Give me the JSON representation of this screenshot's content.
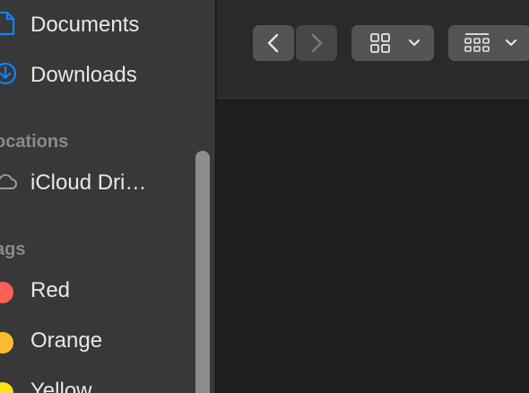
{
  "sidebar": {
    "favorites": [
      {
        "label": "Documents",
        "icon": "document-icon"
      },
      {
        "label": "Downloads",
        "icon": "download-icon"
      }
    ],
    "locations_header": "ocations",
    "locations": [
      {
        "label": "iCloud Dri…",
        "icon": "cloud-icon"
      }
    ],
    "tags_header": "ags",
    "tags": [
      {
        "label": "Red",
        "color": "#fe5f57"
      },
      {
        "label": "Orange",
        "color": "#febc2e"
      },
      {
        "label": "Yellow",
        "color": "#ffe11a"
      }
    ]
  },
  "toolbar": {
    "back_icon": "chevron-left-icon",
    "forward_icon": "chevron-right-icon",
    "view_icon": "grid-view-icon",
    "group_icon": "group-view-icon",
    "dropdown_icon": "chevron-down-icon"
  },
  "colors": {
    "sidebar_bg": "#383838",
    "main_bg": "#1e1e1e",
    "accent": "#0a84ff"
  }
}
